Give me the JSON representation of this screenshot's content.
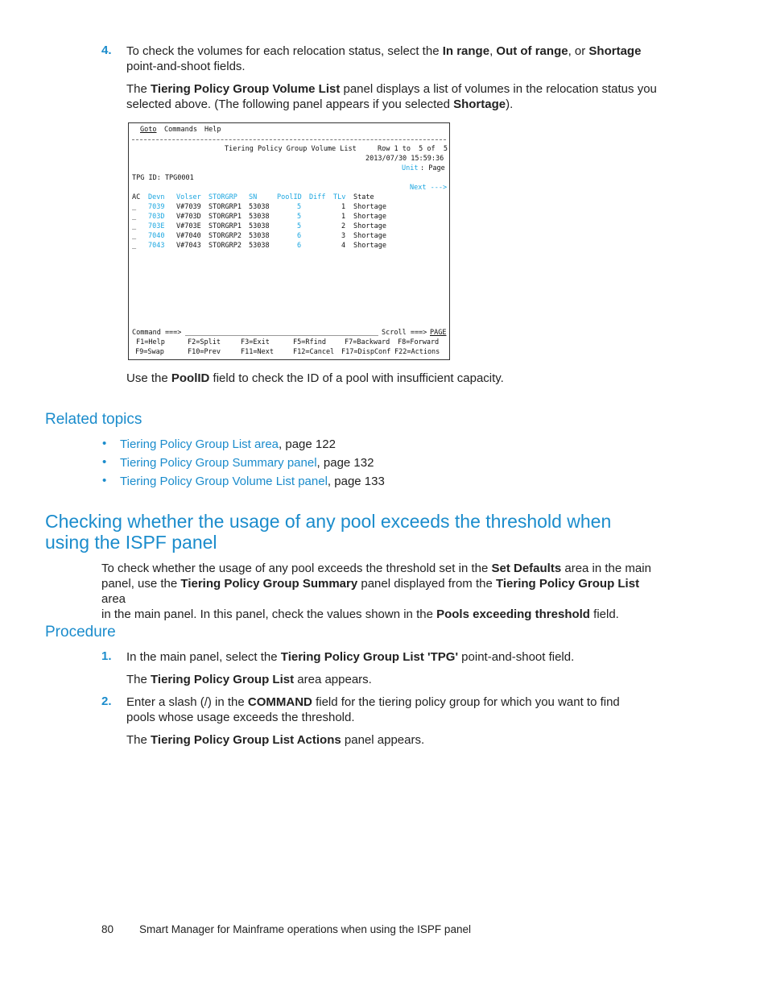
{
  "step4": {
    "num": "4.",
    "line1_pre": "To check the volumes for each relocation status, select the ",
    "in_range": "In range",
    "sep1": ", ",
    "out_of_range": "Out of range",
    "sep2": ", or ",
    "shortage": "Shortage",
    "line2": "point-and-shoot fields.",
    "p2_pre": "The ",
    "p2_bold": "Tiering Policy Group Volume List",
    "p2_post": " panel displays a list of volumes in the relocation status you",
    "p2_line2_pre": "selected above. (The following panel appears if you selected ",
    "p2_line2_bold": "Shortage",
    "p2_line2_post": ")."
  },
  "terminal": {
    "menu": [
      "Goto",
      "Commands",
      "Help"
    ],
    "title": "Tiering Policy Group Volume List",
    "row_info": "Row 1 to  5 of  5",
    "datetime": "2013/07/30 15:59:36",
    "unit_label": "Unit",
    "unit_value": ": Page",
    "tpg_id": "TPG ID: TPG0001",
    "next": "Next --->",
    "columns": [
      "AC",
      "Devn",
      "Volser",
      "STORGRP",
      "SN",
      "PoolID",
      "Diff",
      "TLv",
      "State"
    ],
    "rows": [
      {
        "ac": "_",
        "devn": "7039",
        "volser": "V#7039",
        "storgrp": "STORGRP1",
        "sn": "53038",
        "poolid": "5",
        "diff": "",
        "tlv": "1",
        "state": "Shortage"
      },
      {
        "ac": "_",
        "devn": "703D",
        "volser": "V#703D",
        "storgrp": "STORGRP1",
        "sn": "53038",
        "poolid": "5",
        "diff": "",
        "tlv": "1",
        "state": "Shortage"
      },
      {
        "ac": "_",
        "devn": "703E",
        "volser": "V#703E",
        "storgrp": "STORGRP1",
        "sn": "53038",
        "poolid": "5",
        "diff": "",
        "tlv": "2",
        "state": "Shortage"
      },
      {
        "ac": "_",
        "devn": "7040",
        "volser": "V#7040",
        "storgrp": "STORGRP2",
        "sn": "53038",
        "poolid": "6",
        "diff": "",
        "tlv": "3",
        "state": "Shortage"
      },
      {
        "ac": "_",
        "devn": "7043",
        "volser": "V#7043",
        "storgrp": "STORGRP2",
        "sn": "53038",
        "poolid": "6",
        "diff": "",
        "tlv": "4",
        "state": "Shortage"
      }
    ],
    "command_label": "Command ===>",
    "command_value": "",
    "scroll_label": "Scroll ===>",
    "scroll_value": "PAGE",
    "fkeys1": [
      "F1=Help",
      "F2=Split",
      "F3=Exit",
      "F5=Rfind",
      "F7=Backward",
      "F8=Forward"
    ],
    "fkeys2": [
      "F9=Swap",
      "F10=Prev",
      "F11=Next",
      "F12=Cancel",
      "F17=DispConf",
      "F22=Actions"
    ]
  },
  "poolid_note": {
    "pre": "Use the ",
    "bold": "PoolID",
    "post": " field to check the ID of a pool with insufficient capacity."
  },
  "related": {
    "heading": "Related topics",
    "items": [
      {
        "link": "Tiering Policy Group List area",
        "page": ", page 122"
      },
      {
        "link": "Tiering Policy Group Summary panel",
        "page": ", page 132"
      },
      {
        "link": "Tiering Policy Group Volume List panel",
        "page": ", page 133"
      }
    ]
  },
  "section": {
    "title": "Checking whether the usage of any pool exceeds the threshold when using the ISPF panel",
    "l1_pre": "To check whether the usage of any pool exceeds the threshold set in the ",
    "l1_b": "Set Defaults",
    "l1_post": " area in the main",
    "l2_pre": "panel, use the ",
    "l2_b1": "Tiering Policy Group Summary",
    "l2_mid": " panel displayed from the ",
    "l2_b2": "Tiering Policy Group List",
    "l2_post": " area",
    "l3_pre": "in the main panel. In this panel, check the values shown in the ",
    "l3_b": "Pools exceeding threshold",
    "l3_post": " field."
  },
  "procedure": {
    "heading": "Procedure",
    "s1": {
      "num": "1.",
      "pre": "In the main panel, select the ",
      "bold": "Tiering Policy Group List 'TPG'",
      "post": " point-and-shoot field.",
      "r_pre": "The ",
      "r_bold": "Tiering Policy Group List",
      "r_post": " area appears."
    },
    "s2": {
      "num": "2.",
      "pre": "Enter a slash (/) in the ",
      "bold": "COMMAND",
      "post": " field for the tiering policy group for which you want to find",
      "line2": "pools whose usage exceeds the threshold.",
      "r_pre": "The ",
      "r_bold": "Tiering Policy Group List Actions",
      "r_post": " panel appears."
    }
  },
  "footer": {
    "page": "80",
    "title": "Smart Manager for Mainframe operations when using the ISPF panel"
  },
  "colors": {
    "accent": "#1b8ccc",
    "terminal_field": "#1ba6e0"
  }
}
